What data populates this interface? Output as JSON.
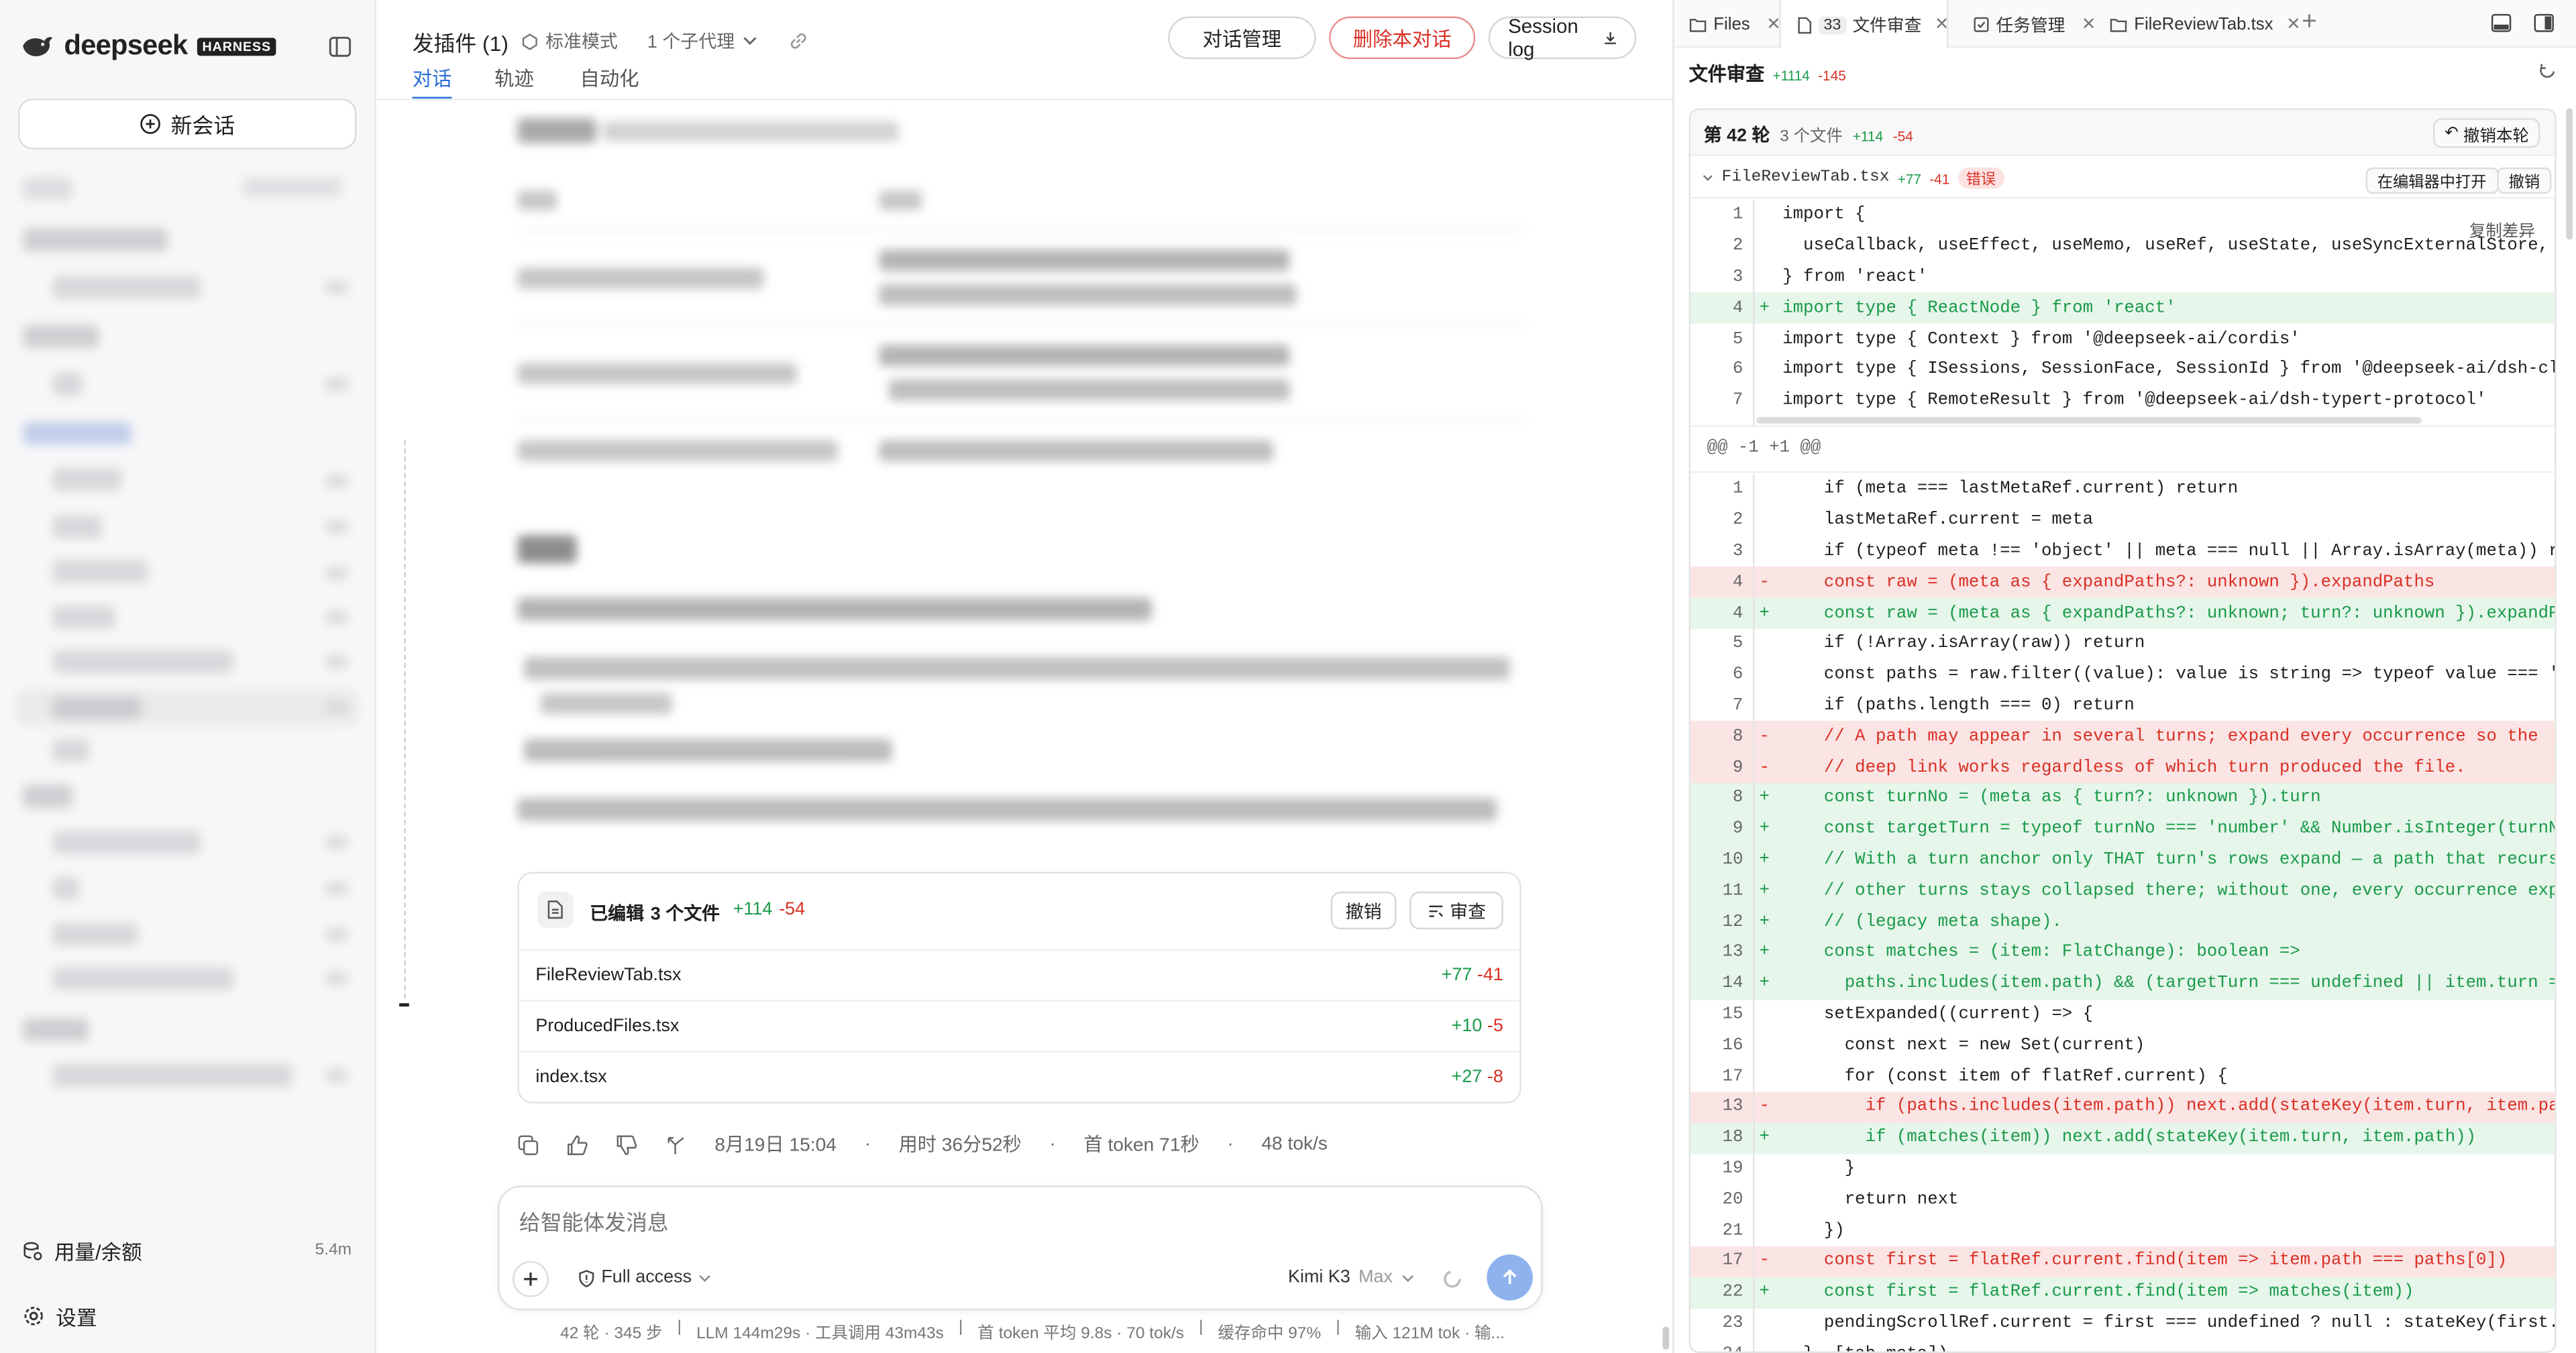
{
  "sidebar": {
    "brand": "deepseek",
    "badge": "HARNESS",
    "new_chat": "新会话",
    "usage_label": "用量/余额",
    "usage_value": "5.4m",
    "settings_label": "设置"
  },
  "header": {
    "title": "发插件 (1)",
    "mode": "标准模式",
    "subagents": "1 个子代理",
    "btn_manage": "对话管理",
    "btn_delete": "删除本对话",
    "btn_log": "Session log",
    "tabs": [
      "对话",
      "轨迹",
      "自动化"
    ]
  },
  "edited_card": {
    "title_prefix": "已编辑",
    "title_count": "3 个文件",
    "plus": "+114",
    "minus": "-54",
    "undo": "撤销",
    "review": "审查",
    "files": [
      {
        "name": "FileReviewTab.tsx",
        "plus": "+77",
        "minus": "-41"
      },
      {
        "name": "ProducedFiles.tsx",
        "plus": "+10",
        "minus": "-5"
      },
      {
        "name": "index.tsx",
        "plus": "+27",
        "minus": "-8"
      }
    ]
  },
  "message_meta": {
    "date": "8月19日 15:04",
    "duration": "用时 36分52秒",
    "first_token": "首 token 71秒",
    "speed": "48 tok/s"
  },
  "composer": {
    "placeholder": "给智能体发消息",
    "access": "Full access",
    "model": "Kimi K3",
    "effort": "Max"
  },
  "status_bar": {
    "turns": "42 轮 · 345 步",
    "llm": "LLM 144m29s · 工具调用 43m43s",
    "token_avg": "首 token 平均 9.8s · 70 tok/s",
    "cache": "缓存命中 97%",
    "input": "输入 121M tok · 输..."
  },
  "right_panel": {
    "tabs": [
      {
        "label": "Files",
        "icon": "folder-icon"
      },
      {
        "label": "文件审查",
        "count": "33",
        "icon": "file-icon"
      },
      {
        "label": "任务管理",
        "icon": "tasks-icon"
      },
      {
        "label": "FileReviewTab.tsx",
        "icon": "folder-icon"
      }
    ],
    "heading": "文件审查",
    "heading_plus": "+1114",
    "heading_minus": "-145",
    "turn_label": "第 42 轮",
    "turn_files": "3 个文件",
    "turn_plus": "+114",
    "turn_minus": "-54",
    "undo_turn": "撤销本轮",
    "file_name": "FileReviewTab.tsx",
    "file_plus": "+77",
    "file_minus": "-41",
    "error_tag": "错误",
    "open_in_editor": "在编辑器中打开",
    "undo_file": "撤销",
    "copy_diff": "复制差异",
    "hunk_header": "@@ -1 +1 @@",
    "header_lines": [
      {
        "n": "1",
        "t": "ctx",
        "code": "import {"
      },
      {
        "n": "2",
        "t": "ctx",
        "code": "  useCallback, useEffect, useMemo, useRef, useState, useSyncExternalStore,"
      },
      {
        "n": "3",
        "t": "ctx",
        "code": "} from 'react'"
      },
      {
        "n": "4",
        "t": "add",
        "code": "import type { ReactNode } from 'react'"
      },
      {
        "n": "5",
        "t": "ctx",
        "code": "import type { Context } from '@deepseek-ai/cordis'"
      },
      {
        "n": "6",
        "t": "ctx",
        "code": "import type { ISessions, SessionFace, SessionId } from '@deepseek-ai/dsh-client-core'"
      },
      {
        "n": "7",
        "t": "ctx",
        "code": "import type { RemoteResult } from '@deepseek-ai/dsh-typert-protocol'"
      }
    ],
    "hunk_lines": [
      {
        "n": "1",
        "t": "ctx",
        "code": "    if (meta === lastMetaRef.current) return"
      },
      {
        "n": "2",
        "t": "ctx",
        "code": "    lastMetaRef.current = meta"
      },
      {
        "n": "3",
        "t": "ctx",
        "code": "    if (typeof meta !== 'object' || meta === null || Array.isArray(meta)) return"
      },
      {
        "n": "4",
        "t": "del",
        "code": "    const raw = (meta as { expandPaths?: unknown }).expandPaths"
      },
      {
        "n": "4",
        "t": "add",
        "code": "    const raw = (meta as { expandPaths?: unknown; turn?: unknown }).expandPaths"
      },
      {
        "n": "5",
        "t": "ctx",
        "code": "    if (!Array.isArray(raw)) return"
      },
      {
        "n": "6",
        "t": "ctx",
        "code": "    const paths = raw.filter((value): value is string => typeof value === 'string')"
      },
      {
        "n": "7",
        "t": "ctx",
        "code": "    if (paths.length === 0) return"
      },
      {
        "n": "8",
        "t": "del",
        "code": "    // A path may appear in several turns; expand every occurrence so the"
      },
      {
        "n": "9",
        "t": "del",
        "code": "    // deep link works regardless of which turn produced the file."
      },
      {
        "n": "8",
        "t": "add",
        "code": "    const turnNo = (meta as { turn?: unknown }).turn"
      },
      {
        "n": "9",
        "t": "add",
        "code": "    const targetTurn = typeof turnNo === 'number' && Number.isInteger(turnNo) ? turnNo : undefined"
      },
      {
        "n": "10",
        "t": "add",
        "code": "    // With a turn anchor only THAT turn's rows expand — a path that recurs in"
      },
      {
        "n": "11",
        "t": "add",
        "code": "    // other turns stays collapsed there; without one, every occurrence expands"
      },
      {
        "n": "12",
        "t": "add",
        "code": "    // (legacy meta shape)."
      },
      {
        "n": "13",
        "t": "add",
        "code": "    const matches = (item: FlatChange): boolean =>"
      },
      {
        "n": "14",
        "t": "add",
        "code": "      paths.includes(item.path) && (targetTurn === undefined || item.turn === targetTurn)"
      },
      {
        "n": "15",
        "t": "ctx",
        "code": "    setExpanded((current) => {"
      },
      {
        "n": "16",
        "t": "ctx",
        "code": "      const next = new Set(current)"
      },
      {
        "n": "17",
        "t": "ctx",
        "code": "      for (const item of flatRef.current) {"
      },
      {
        "n": "13",
        "t": "del",
        "code": "        if (paths.includes(item.path)) next.add(stateKey(item.turn, item.path))"
      },
      {
        "n": "18",
        "t": "add",
        "code": "        if (matches(item)) next.add(stateKey(item.turn, item.path))"
      },
      {
        "n": "19",
        "t": "ctx",
        "code": "      }"
      },
      {
        "n": "20",
        "t": "ctx",
        "code": "      return next"
      },
      {
        "n": "21",
        "t": "ctx",
        "code": "    })"
      },
      {
        "n": "17",
        "t": "del",
        "code": "    const first = flatRef.current.find(item => item.path === paths[0])"
      },
      {
        "n": "22",
        "t": "add",
        "code": "    const first = flatRef.current.find(item => matches(item))"
      },
      {
        "n": "23",
        "t": "ctx",
        "code": "    pendingScrollRef.current = first === undefined ? null : stateKey(first.turn, first.path)"
      },
      {
        "n": "24",
        "t": "ctx",
        "code": "  }, [tab.meta])"
      }
    ]
  }
}
